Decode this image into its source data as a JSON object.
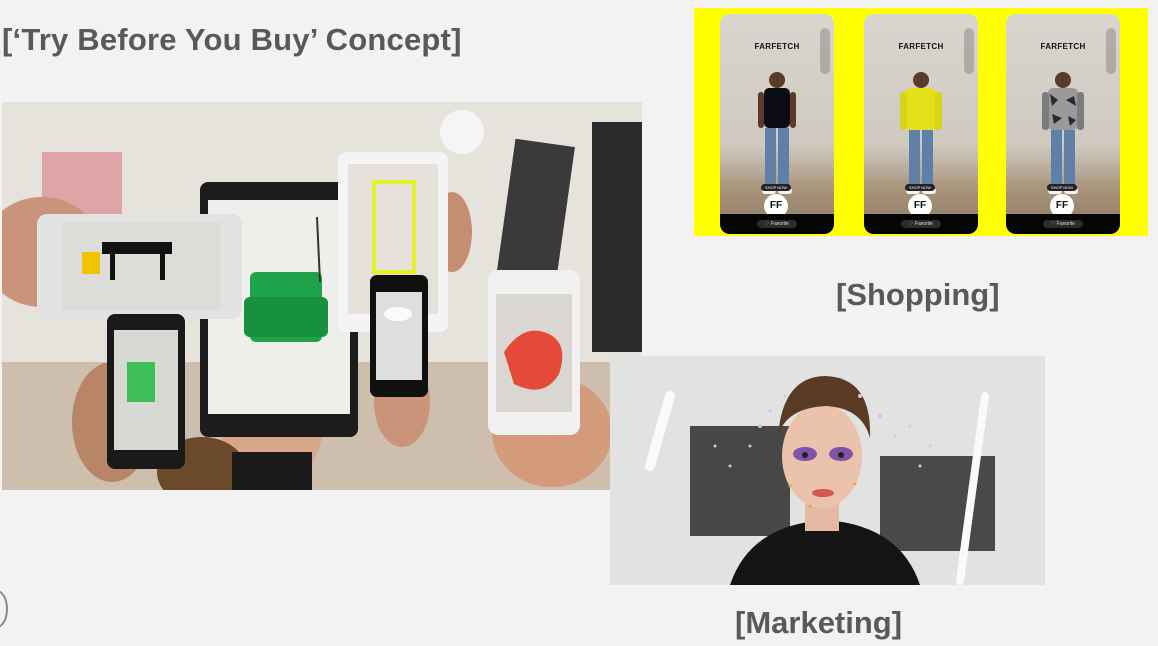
{
  "slide": {
    "title": "[‘Try Before You Buy’ Concept]",
    "caption_shopping": "[Shopping]",
    "caption_marketing": "[Marketing]"
  },
  "shopping_panel": {
    "background": "#ffff00",
    "phones": [
      {
        "brand": "FARFETCH",
        "shop_label": "SHOP NOW",
        "favorite_label": "♡ Favorite",
        "logo_text": "FF",
        "shirt_color": "#0c0c14"
      },
      {
        "brand": "FARFETCH",
        "shop_label": "SHOP NOW",
        "favorite_label": "♡ Favorite",
        "logo_text": "FF",
        "shirt_color": "#e4e01a"
      },
      {
        "brand": "FARFETCH",
        "shop_label": "SHOP NOW",
        "favorite_label": "♡ Favorite",
        "logo_text": "FF",
        "shirt_color": "#9a9a9a"
      }
    ]
  }
}
